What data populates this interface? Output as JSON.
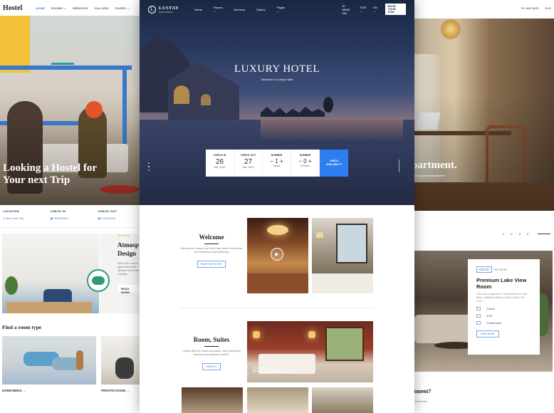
{
  "hostel": {
    "logo": "Hostel",
    "nav": [
      "HOME",
      "ROOMS ⌄",
      "SERVICES",
      "GALLERY",
      "PAGES ⌄"
    ],
    "hero_title": "Looking a Hostel for Your next Trip",
    "booking": [
      {
        "label": "LOCATION",
        "value": "New York City"
      },
      {
        "label": "CHECK IN",
        "value": "26/03/2020"
      },
      {
        "label": "CHECK OUT",
        "value": "27/03/2020"
      }
    ],
    "story_tag": "Our Story",
    "story_title": "Atmosp Design",
    "story_text": "Since 2014, we've ages anyone the Whether it's for one in a foreign",
    "read_more": "READ MORE",
    "find_title": "Find a room type",
    "rooms": [
      "DORM BEDS →",
      "PRIVATE ROOM →"
    ]
  },
  "lustay": {
    "logo_name": "LUSTAY",
    "logo_sub": "Hotel & Resort",
    "logo_mark": "L",
    "nav": [
      "Home",
      "Rooms ⌄",
      "Services",
      "Gallery",
      "Pages ⌄"
    ],
    "phone": "18000 786",
    "currency": "EUR ⌄",
    "lang": "EN ⌄",
    "book_btn": "BOOK YOUR STAY",
    "hero_title": "LUXURY HOTEL",
    "hero_sub": "Welcome to Lustay Hotel",
    "booking": {
      "check_in": {
        "label": "CHECK IN",
        "day": "26",
        "month": "Mar, 2020"
      },
      "check_out": {
        "label": "CHECK OUT",
        "day": "27",
        "month": "Mar, 2020"
      },
      "adults": {
        "label": "NUMBER",
        "value": "− 1 +",
        "unit": "Adults"
      },
      "children": {
        "label": "NUMBER",
        "value": "− 0 +",
        "unit": "Children"
      },
      "cta": "CHECK AVAILABILITY"
    },
    "welcome": {
      "title": "Welcome",
      "text": "Welcome to Lustay Hotel, the 5-star hotel in which you can experience total wellbeing.",
      "button": "READ OUR STORY"
    },
    "rooms": {
      "title": "Room, Suites",
      "text": "Lustay offers 40 rooms and suites, each presenting luxurious and welcome comfort.",
      "button": "VIEW ALL",
      "featured_from": "From €140/night",
      "featured_name": "Royal Arrondire Suite"
    }
  },
  "apartment": {
    "phone": "1800 5678",
    "currency": "EUR",
    "hero_title": "partment.",
    "hero_tag": "meets your needs whether",
    "pagination": [
      "1",
      "2",
      "3",
      "4"
    ],
    "card": {
      "price": "€50.00",
      "per": "PER NIGHT",
      "title": "Premium Lake View Room",
      "desc": "This room comprises of 1 Double Bed or 2 Twin Beds, 2 Bedside Tables, a Desk & Chair. The room...",
      "amenities": [
        "2 beds",
        "24 ft²",
        "2 bathrooms"
      ],
      "button": "VIEW MORE"
    },
    "question": "rtment?",
    "question_sub": "splendid kits"
  }
}
